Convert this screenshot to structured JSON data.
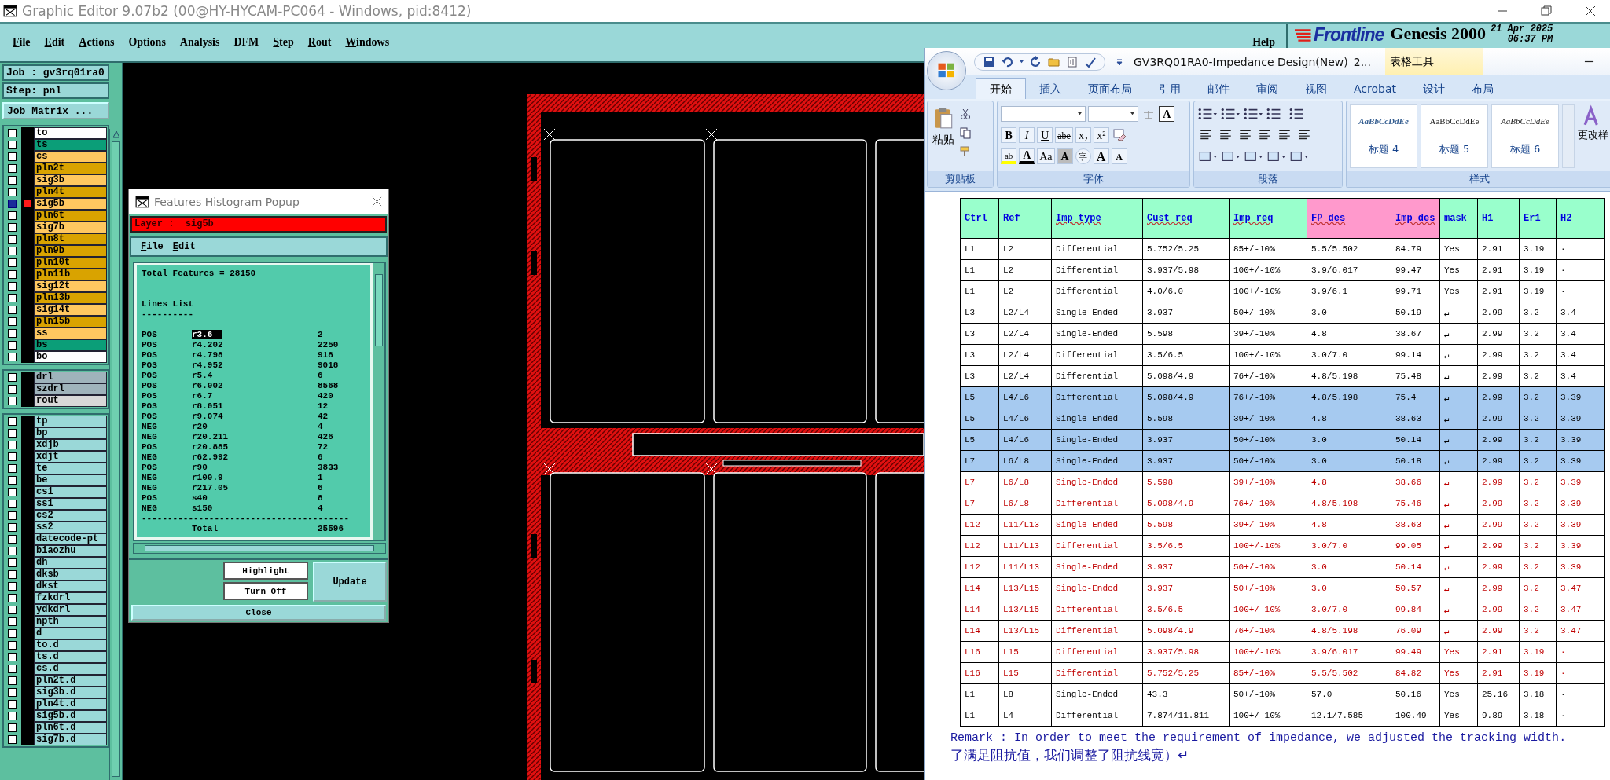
{
  "title_bar": {
    "title": "Graphic Editor 9.07b2 (00@HY-HYCAM-PC064 - Windows, pid:8412)"
  },
  "menu": [
    {
      "label": "File",
      "mnemonic": true
    },
    {
      "label": "Edit",
      "mnemonic": true
    },
    {
      "label": "Actions",
      "mnemonic": true
    },
    {
      "label": "Options",
      "mnemonic": false
    },
    {
      "label": "Analysis",
      "mnemonic": false
    },
    {
      "label": "DFM",
      "mnemonic": false
    },
    {
      "label": "Step",
      "mnemonic": true
    },
    {
      "label": "Rout",
      "mnemonic": true
    },
    {
      "label": "Windows",
      "mnemonic": true
    }
  ],
  "help": "Help",
  "brand": {
    "logo": "Frontline",
    "product": "Genesis 2000",
    "date": "21 Apr 2025",
    "time": "06:37 PM"
  },
  "job": "Job : gv3rq01ra0",
  "step": "Step: pnl",
  "job_matrix_button": "Job Matrix ...",
  "layer_groups": [
    {
      "layers": [
        {
          "name": "to",
          "color": "#ffffff",
          "selected": false
        },
        {
          "name": "ts",
          "color": "#0b9e78",
          "selected": false
        },
        {
          "name": "cs",
          "color": "#ffc860",
          "selected": false
        },
        {
          "name": "pln2t",
          "color": "#d9a300",
          "selected": false
        },
        {
          "name": "sig3b",
          "color": "#ffc860",
          "selected": false
        },
        {
          "name": "pln4t",
          "color": "#d9a300",
          "selected": false
        },
        {
          "name": "sig5b",
          "color": "#ffc860",
          "selected": true
        },
        {
          "name": "pln6t",
          "color": "#d9a300",
          "selected": false
        },
        {
          "name": "sig7b",
          "color": "#ffc860",
          "selected": false
        },
        {
          "name": "pln8t",
          "color": "#d9a300",
          "selected": false
        },
        {
          "name": "pln9b",
          "color": "#d9a300",
          "selected": false
        },
        {
          "name": "pln10t",
          "color": "#d9a300",
          "selected": false
        },
        {
          "name": "pln11b",
          "color": "#d9a300",
          "selected": false
        },
        {
          "name": "sig12t",
          "color": "#ffc860",
          "selected": false
        },
        {
          "name": "pln13b",
          "color": "#d9a300",
          "selected": false
        },
        {
          "name": "sig14t",
          "color": "#ffc860",
          "selected": false
        },
        {
          "name": "pln15b",
          "color": "#d9a300",
          "selected": false
        },
        {
          "name": "ss",
          "color": "#ffc860",
          "selected": false
        },
        {
          "name": "bs",
          "color": "#0b9e78",
          "selected": false
        },
        {
          "name": "bo",
          "color": "#ffffff",
          "selected": false
        }
      ]
    },
    {
      "layers": [
        {
          "name": "drl",
          "color": "#9fb3bb",
          "selected": false
        },
        {
          "name": "szdrl",
          "color": "#9fb3bb",
          "selected": false
        },
        {
          "name": "rout",
          "color": "#d8d8d8",
          "selected": false
        }
      ]
    },
    {
      "layers": [
        {
          "name": "tp",
          "color": "#9ad8d8",
          "selected": false
        },
        {
          "name": "bp",
          "color": "#9ad8d8",
          "selected": false
        },
        {
          "name": "xdjb",
          "color": "#9ad8d8",
          "selected": false
        },
        {
          "name": "xdjt",
          "color": "#9ad8d8",
          "selected": false
        },
        {
          "name": "te",
          "color": "#9ad8d8",
          "selected": false
        },
        {
          "name": "be",
          "color": "#9ad8d8",
          "selected": false
        },
        {
          "name": "cs1",
          "color": "#9ad8d8",
          "selected": false
        },
        {
          "name": "ss1",
          "color": "#9ad8d8",
          "selected": false
        },
        {
          "name": "cs2",
          "color": "#9ad8d8",
          "selected": false
        },
        {
          "name": "ss2",
          "color": "#9ad8d8",
          "selected": false
        },
        {
          "name": "datecode-pt",
          "color": "#9ad8d8",
          "selected": false
        },
        {
          "name": "biaozhu",
          "color": "#9ad8d8",
          "selected": false
        },
        {
          "name": "dh",
          "color": "#9ad8d8",
          "selected": false
        },
        {
          "name": "dksb",
          "color": "#9ad8d8",
          "selected": false
        },
        {
          "name": "dkst",
          "color": "#9ad8d8",
          "selected": false
        },
        {
          "name": "fzkdrl",
          "color": "#9ad8d8",
          "selected": false
        },
        {
          "name": "ydkdrl",
          "color": "#9ad8d8",
          "selected": false
        },
        {
          "name": "npth",
          "color": "#9ad8d8",
          "selected": false
        },
        {
          "name": "d",
          "color": "#9ad8d8",
          "selected": false
        },
        {
          "name": "to.d",
          "color": "#9ad8d8",
          "selected": false
        },
        {
          "name": "ts.d",
          "color": "#9ad8d8",
          "selected": false
        },
        {
          "name": "cs.d",
          "color": "#9ad8d8",
          "selected": false
        },
        {
          "name": "pln2t.d",
          "color": "#9ad8d8",
          "selected": false
        },
        {
          "name": "sig3b.d",
          "color": "#9ad8d8",
          "selected": false
        },
        {
          "name": "pln4t.d",
          "color": "#9ad8d8",
          "selected": false
        },
        {
          "name": "sig5b.d",
          "color": "#9ad8d8",
          "selected": false
        },
        {
          "name": "pln6t.d",
          "color": "#9ad8d8",
          "selected": false
        },
        {
          "name": "sig7b.d",
          "color": "#9ad8d8",
          "selected": false
        }
      ]
    }
  ],
  "popup": {
    "title": "Features Histogram Popup",
    "layer": "Layer :  sig5b",
    "menu": [
      "File",
      "Edit"
    ],
    "total_features": "Total Features = 28150",
    "list_title": "Lines List",
    "list_rule": "----------",
    "lines": [
      {
        "polarity": "POS",
        "symbol": "r3.6",
        "count": "2",
        "selected": true
      },
      {
        "polarity": "POS",
        "symbol": "r4.202",
        "count": "2250",
        "selected": false
      },
      {
        "polarity": "POS",
        "symbol": "r4.798",
        "count": "918",
        "selected": false
      },
      {
        "polarity": "POS",
        "symbol": "r4.952",
        "count": "9018",
        "selected": false
      },
      {
        "polarity": "POS",
        "symbol": "r5.4",
        "count": "6",
        "selected": false
      },
      {
        "polarity": "POS",
        "symbol": "r6.002",
        "count": "8568",
        "selected": false
      },
      {
        "polarity": "POS",
        "symbol": "r6.7",
        "count": "420",
        "selected": false
      },
      {
        "polarity": "POS",
        "symbol": "r8.051",
        "count": "12",
        "selected": false
      },
      {
        "polarity": "POS",
        "symbol": "r9.074",
        "count": "42",
        "selected": false
      },
      {
        "polarity": "NEG",
        "symbol": "r20",
        "count": "4",
        "selected": false
      },
      {
        "polarity": "NEG",
        "symbol": "r20.211",
        "count": "426",
        "selected": false
      },
      {
        "polarity": "POS",
        "symbol": "r20.885",
        "count": "72",
        "selected": false
      },
      {
        "polarity": "NEG",
        "symbol": "r62.992",
        "count": "6",
        "selected": false
      },
      {
        "polarity": "POS",
        "symbol": "r90",
        "count": "3833",
        "selected": false
      },
      {
        "polarity": "NEG",
        "symbol": "r100.9",
        "count": "1",
        "selected": false
      },
      {
        "polarity": "NEG",
        "symbol": "r217.05",
        "count": "6",
        "selected": false
      },
      {
        "polarity": "POS",
        "symbol": "s40",
        "count": "8",
        "selected": false
      },
      {
        "polarity": "NEG",
        "symbol": "s150",
        "count": "4",
        "selected": false
      }
    ],
    "total_rule": "----------------------------------------",
    "total_label": "Total",
    "total": "25596",
    "highlight": "Highlight",
    "turn_off": "Turn Off",
    "update": "Update",
    "close": "Close"
  },
  "word": {
    "title": "GV3RQ01RA0-Impedance Design(New)_2...",
    "context_tab": "表格工具",
    "tabs": [
      {
        "label": "开始",
        "selected": true
      },
      {
        "label": "插入",
        "selected": false
      },
      {
        "label": "页面布局",
        "selected": false
      },
      {
        "label": "引用",
        "selected": false
      },
      {
        "label": "邮件",
        "selected": false
      },
      {
        "label": "审阅",
        "selected": false
      },
      {
        "label": "视图",
        "selected": false
      },
      {
        "label": "Acrobat",
        "selected": false
      },
      {
        "label": "设计",
        "selected": false
      },
      {
        "label": "布局",
        "selected": false
      }
    ],
    "clipboard": {
      "paste": "粘贴",
      "label": "剪贴板"
    },
    "font": {
      "label": "字体",
      "boxed": "A",
      "row_1": [
        {
          "text": "B",
          "kind": "bold"
        },
        {
          "text": "I",
          "kind": "italic"
        },
        {
          "text": "U",
          "kind": "underline"
        },
        {
          "text": "abe",
          "kind": "strike"
        },
        {
          "text": "x₂",
          "kind": "plain"
        },
        {
          "text": "x²",
          "kind": "plain"
        }
      ],
      "row_2": [
        {
          "text": "ab",
          "kind": "highlight"
        },
        {
          "text": "A",
          "kind": "font-color"
        },
        {
          "text": "Aa",
          "kind": "plain"
        },
        {
          "text": "A",
          "kind": "shaded"
        },
        {
          "text": "字",
          "kind": "enclosed"
        },
        {
          "text": "A",
          "kind": "grow"
        },
        {
          "text": "A",
          "kind": "shrink"
        }
      ]
    },
    "paragraph": {
      "label": "段落"
    },
    "styles": {
      "label": "样式",
      "change": "更改样",
      "items": [
        {
          "preview": "AaBbCcDdEe",
          "name": "标题 4",
          "kind": "accent"
        },
        {
          "preview": "AaBbCcDdEe",
          "name": "标题 5",
          "kind": "plain"
        },
        {
          "preview": "AaBbCcDdEe",
          "name": "标题 6",
          "kind": "emphasis"
        }
      ]
    },
    "table": {
      "columns": [
        {
          "label": "Ctrl",
          "color": "#99ffcc",
          "flagged": false
        },
        {
          "label": "Ref",
          "color": "#99ffcc",
          "flagged": false
        },
        {
          "label": "Imp_type",
          "color": "#99ffcc",
          "flagged": true
        },
        {
          "label": "Cust_req",
          "color": "#99ffcc",
          "flagged": true
        },
        {
          "label": "Imp_req",
          "color": "#99ffcc",
          "flagged": true
        },
        {
          "label": "FP_des",
          "color": "#ff99cc",
          "flagged": true
        },
        {
          "label": "Imp_des",
          "color": "#ff99cc",
          "flagged": true
        },
        {
          "label": "mask",
          "color": "#99ffcc",
          "flagged": false
        },
        {
          "label": "H1",
          "color": "#99ffcc",
          "flagged": false
        },
        {
          "label": "Er1",
          "color": "#99ffcc",
          "flagged": false
        },
        {
          "label": "H2",
          "color": "#99ffcc",
          "flagged": false
        }
      ],
      "rows": [
        {
          "cells": [
            "L1",
            "L2",
            "Differential",
            "5.752/5.25",
            "85+/-10%",
            "5.5/5.502",
            "84.79",
            "Yes",
            "2.91",
            "3.19",
            "·"
          ],
          "selected": false,
          "color": "#000000"
        },
        {
          "cells": [
            "L1",
            "L2",
            "Differential",
            "3.937/5.98",
            "100+/-10%",
            "3.9/6.017",
            "99.47",
            "Yes",
            "2.91",
            "3.19",
            "·"
          ],
          "selected": false,
          "color": "#000000"
        },
        {
          "cells": [
            "L1",
            "L2",
            "Differential",
            "4.0/6.0",
            "100+/-10%",
            "3.9/6.1",
            "99.71",
            "Yes",
            "2.91",
            "3.19",
            "·"
          ],
          "selected": false,
          "color": "#000000"
        },
        {
          "cells": [
            "L3",
            "L2/L4",
            "Single-Ended",
            "3.937",
            "50+/-10%",
            "3.0",
            "50.19",
            "↵",
            "2.99",
            "3.2",
            "3.4"
          ],
          "selected": false,
          "color": "#000000"
        },
        {
          "cells": [
            "L3",
            "L2/L4",
            "Single-Ended",
            "5.598",
            "39+/-10%",
            "4.8",
            "38.67",
            "↵",
            "2.99",
            "3.2",
            "3.4"
          ],
          "selected": false,
          "color": "#000000"
        },
        {
          "cells": [
            "L3",
            "L2/L4",
            "Differential",
            "3.5/6.5",
            "100+/-10%",
            "3.0/7.0",
            "99.14",
            "↵",
            "2.99",
            "3.2",
            "3.4"
          ],
          "selected": false,
          "color": "#000000"
        },
        {
          "cells": [
            "L3",
            "L2/L4",
            "Differential",
            "5.098/4.9",
            "76+/-10%",
            "4.8/5.198",
            "75.48",
            "↵",
            "2.99",
            "3.2",
            "3.4"
          ],
          "selected": false,
          "color": "#000000"
        },
        {
          "cells": [
            "L5",
            "L4/L6",
            "Differential",
            "5.098/4.9",
            "76+/-10%",
            "4.8/5.198",
            "75.4",
            "↵",
            "2.99",
            "3.2",
            "3.39"
          ],
          "selected": true,
          "color": "#000000"
        },
        {
          "cells": [
            "L5",
            "L4/L6",
            "Single-Ended",
            "5.598",
            "39+/-10%",
            "4.8",
            "38.63",
            "↵",
            "2.99",
            "3.2",
            "3.39"
          ],
          "selected": true,
          "color": "#000000"
        },
        {
          "cells": [
            "L5",
            "L4/L6",
            "Single-Ended",
            "3.937",
            "50+/-10%",
            "3.0",
            "50.14",
            "↵",
            "2.99",
            "3.2",
            "3.39"
          ],
          "selected": true,
          "color": "#000000"
        },
        {
          "cells": [
            "L7",
            "L6/L8",
            "Single-Ended",
            "3.937",
            "50+/-10%",
            "3.0",
            "50.18",
            "↵",
            "2.99",
            "3.2",
            "3.39"
          ],
          "selected": true,
          "color": "#000000"
        },
        {
          "cells": [
            "L7",
            "L6/L8",
            "Single-Ended",
            "5.598",
            "39+/-10%",
            "4.8",
            "38.66",
            "↵",
            "2.99",
            "3.2",
            "3.39"
          ],
          "selected": false,
          "color": "#c00000"
        },
        {
          "cells": [
            "L7",
            "L6/L8",
            "Differential",
            "5.098/4.9",
            "76+/-10%",
            "4.8/5.198",
            "75.46",
            "↵",
            "2.99",
            "3.2",
            "3.39"
          ],
          "selected": false,
          "color": "#c00000"
        },
        {
          "cells": [
            "L12",
            "L11/L13",
            "Single-Ended",
            "5.598",
            "39+/-10%",
            "4.8",
            "38.63",
            "↵",
            "2.99",
            "3.2",
            "3.39"
          ],
          "selected": false,
          "color": "#c00000"
        },
        {
          "cells": [
            "L12",
            "L11/L13",
            "Differential",
            "3.5/6.5",
            "100+/-10%",
            "3.0/7.0",
            "99.05",
            "↵",
            "2.99",
            "3.2",
            "3.39"
          ],
          "selected": false,
          "color": "#c00000"
        },
        {
          "cells": [
            "L12",
            "L11/L13",
            "Single-Ended",
            "3.937",
            "50+/-10%",
            "3.0",
            "50.14",
            "↵",
            "2.99",
            "3.2",
            "3.39"
          ],
          "selected": false,
          "color": "#c00000"
        },
        {
          "cells": [
            "L14",
            "L13/L15",
            "Single-Ended",
            "3.937",
            "50+/-10%",
            "3.0",
            "50.57",
            "↵",
            "2.99",
            "3.2",
            "3.47"
          ],
          "selected": false,
          "color": "#c00000"
        },
        {
          "cells": [
            "L14",
            "L13/L15",
            "Differential",
            "3.5/6.5",
            "100+/-10%",
            "3.0/7.0",
            "99.84",
            "↵",
            "2.99",
            "3.2",
            "3.47"
          ],
          "selected": false,
          "color": "#c00000"
        },
        {
          "cells": [
            "L14",
            "L13/L15",
            "Differential",
            "5.098/4.9",
            "76+/-10%",
            "4.8/5.198",
            "76.09",
            "↵",
            "2.99",
            "3.2",
            "3.47"
          ],
          "selected": false,
          "color": "#c00000"
        },
        {
          "cells": [
            "L16",
            "L15",
            "Differential",
            "3.937/5.98",
            "100+/-10%",
            "3.9/6.017",
            "99.49",
            "Yes",
            "2.91",
            "3.19",
            "·"
          ],
          "selected": false,
          "color": "#c00000"
        },
        {
          "cells": [
            "L16",
            "L15",
            "Differential",
            "5.752/5.25",
            "85+/-10%",
            "5.5/5.502",
            "84.82",
            "Yes",
            "2.91",
            "3.19",
            "·"
          ],
          "selected": false,
          "color": "#c00000"
        },
        {
          "cells": [
            "L1",
            "L8",
            "Single-Ended",
            "43.3",
            "50+/-10%",
            "57.0",
            "50.16",
            "Yes",
            "25.16",
            "3.18",
            "·"
          ],
          "selected": false,
          "color": "#000000"
        },
        {
          "cells": [
            "L1",
            "L4",
            "Differential",
            "7.874/11.811",
            "100+/-10%",
            "12.1/7.585",
            "100.49",
            "Yes",
            "9.89",
            "3.18",
            "·"
          ],
          "selected": false,
          "color": "#000000"
        }
      ]
    },
    "remark": "Remark : In order to meet the requirement of impedance, we adjusted the tracking width.",
    "remark_cn": "了满足阻抗值，我们调整了阻抗线宽）↵"
  }
}
